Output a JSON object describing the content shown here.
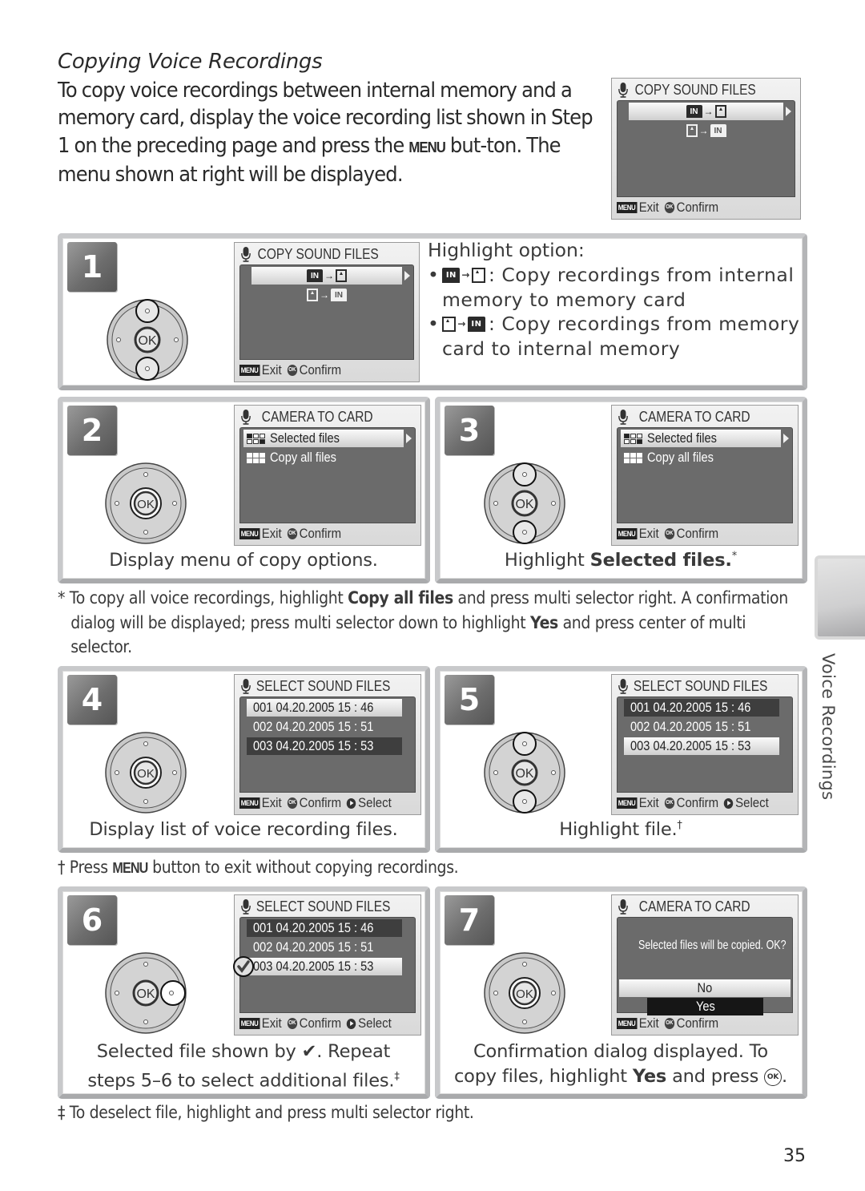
{
  "page": {
    "section_title": "Copying Voice Recordings",
    "intro_parts": [
      "To copy voice recordings between internal memory and a memory card, display the voice recording list shown in Step 1 on the preceding page and press the ",
      "MENU",
      " but-ton.  The menu shown at right will be displayed."
    ],
    "side_tab_label": "Voice Recordings",
    "page_number": "35"
  },
  "icons": {
    "microphone": "microphone-icon",
    "menu_button": "MENU",
    "ok_button": "OK",
    "play_button": "play-icon",
    "internal_memory": "IN",
    "memory_card": "card-icon",
    "checkmark": "✔"
  },
  "lcd_common": {
    "exit": "Exit",
    "confirm": "Confirm",
    "select": "Select",
    "menu": "MENU",
    "ok": "OK"
  },
  "intro_lcd": {
    "title": "COPY SOUND FILES",
    "options": [
      "IN→card",
      "card→IN"
    ],
    "highlighted": 0
  },
  "steps": [
    {
      "number": "1",
      "lcd_title": "COPY SOUND FILES",
      "heading": "Highlight option:",
      "bullets": [
        {
          "text": ": Copy recordings from internal",
          "cont": "memory to memory card"
        },
        {
          "text": ": Copy recordings from memory",
          "cont": "card to internal memory"
        }
      ]
    },
    {
      "number": "2",
      "lcd_title": "CAMERA TO CARD",
      "options": [
        "Selected files",
        "Copy all files"
      ],
      "caption": "Display menu of copy options."
    },
    {
      "number": "3",
      "lcd_title": "CAMERA TO CARD",
      "options": [
        "Selected files",
        "Copy all files"
      ],
      "caption_pre": "Highlight ",
      "caption_bold": "Selected files.",
      "caption_mark": "*"
    },
    {
      "number": "4",
      "lcd_title": "SELECT SOUND FILES",
      "files": [
        "001 04.20.2005  15 : 46",
        "002 04.20.2005  15 : 51",
        "003 04.20.2005  15 : 53"
      ],
      "caption": "Display list of voice recording files."
    },
    {
      "number": "5",
      "lcd_title": "SELECT SOUND FILES",
      "files": [
        "001 04.20.2005  15 : 46",
        "002 04.20.2005  15 : 51",
        "003 04.20.2005  15 : 53"
      ],
      "caption": "Highlight file.",
      "caption_mark": "†"
    },
    {
      "number": "6",
      "lcd_title": "SELECT SOUND FILES",
      "files": [
        "001 04.20.2005  15 : 46",
        "002 04.20.2005  15 : 51",
        "003 04.20.2005  15 : 53"
      ],
      "caption_line1": "Selected file shown by ✔.  Repeat",
      "caption_line2": "steps 5–6 to select additional files.",
      "caption_mark": "‡"
    },
    {
      "number": "7",
      "lcd_title": "CAMERA TO CARD",
      "message": "Selected files will be copied. OK?",
      "choices": [
        "No",
        "Yes"
      ],
      "caption_line1": "Confirmation dialog displayed.  To",
      "caption_line2_pre": "copy files, highlight ",
      "caption_line2_bold": "Yes",
      "caption_line2_post": " and press ",
      "caption_line2_end": "."
    }
  ],
  "notes": {
    "asterisk": {
      "mark": "*",
      "pre": "To copy all voice recordings, highlight ",
      "bold1": "Copy all files",
      "mid": " and press multi selector right.  A confirmation dialog will be displayed; press multi selector down to highlight ",
      "bold2": "Yes",
      "post": " and press center of multi selector."
    },
    "dagger": {
      "mark": "†",
      "pre": " Press ",
      "menu": "MENU",
      "post": " button to exit without copying recordings."
    },
    "double_dagger": {
      "mark": "‡",
      "text": " To deselect file, highlight and press multi selector right."
    }
  }
}
